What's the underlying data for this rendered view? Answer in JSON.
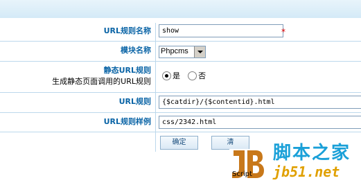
{
  "form": {
    "url_rule_name": {
      "label": "URL规则名称",
      "value": "show",
      "required_mark": "*"
    },
    "module_name": {
      "label": "模块名称",
      "selected": "Phpcms"
    },
    "static_rule": {
      "label": "静态URL规则",
      "hint": "生成静态页面调用的URL规则",
      "options": [
        {
          "label": "是",
          "checked": true
        },
        {
          "label": "否",
          "checked": false
        }
      ]
    },
    "url_rule": {
      "label": "URL规则",
      "value": "{$catdir}/{$contentid}.html"
    },
    "url_example": {
      "label": "URL规则样例",
      "value": "css/2342.html"
    },
    "buttons": {
      "confirm": "确定",
      "clear": "清"
    }
  },
  "watermark": {
    "cn": "脚本之家",
    "url": "jb51.net",
    "script": "Script",
    "logo": "JB"
  }
}
